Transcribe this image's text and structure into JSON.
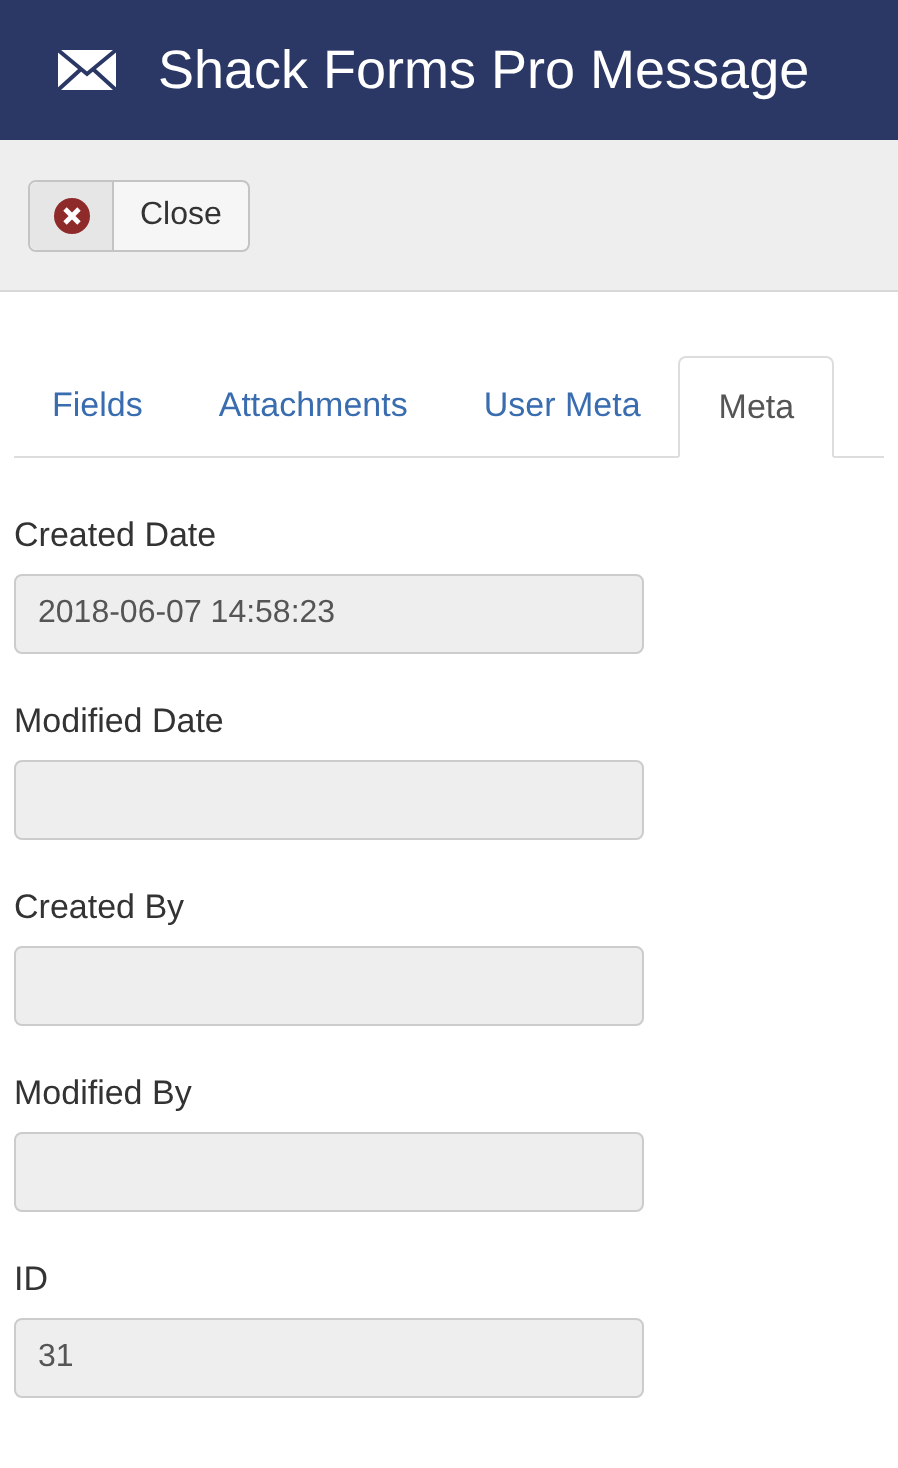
{
  "header": {
    "title": "Shack Forms Pro Message"
  },
  "toolbar": {
    "buttons": [
      {
        "label": "Close",
        "kind": "close"
      }
    ]
  },
  "tabs": [
    {
      "label": "Fields",
      "selected": false
    },
    {
      "label": "Attachments",
      "selected": false
    },
    {
      "label": "User Meta",
      "selected": false
    },
    {
      "label": "Meta",
      "selected": true
    }
  ],
  "fields": [
    {
      "label": "Created Date",
      "value": "2018-06-07 14:58:23"
    },
    {
      "label": "Modified Date"
    },
    {
      "label": "Created By"
    },
    {
      "label": "Modified By"
    },
    {
      "label": "ID",
      "value": "31"
    }
  ]
}
